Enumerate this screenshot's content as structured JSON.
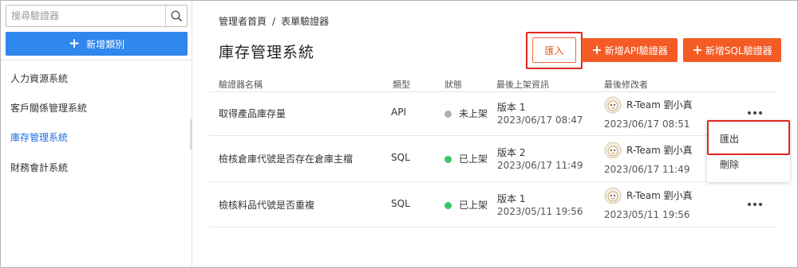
{
  "sidebar": {
    "search_placeholder": "搜尋驗證器",
    "add_category_label": "新增類別",
    "items": [
      {
        "label": "人力資源系統",
        "active": false
      },
      {
        "label": "客戶關係管理系統",
        "active": false
      },
      {
        "label": "庫存管理系統",
        "active": true
      },
      {
        "label": "財務會計系統",
        "active": false
      }
    ]
  },
  "breadcrumb": {
    "home": "管理者首頁",
    "separator": "/",
    "current": "表單驗證器"
  },
  "page_title": "庫存管理系統",
  "toolbar": {
    "import_label": "匯入",
    "add_api_label": "新增API驗證器",
    "add_sql_label": "新增SQL驗證器"
  },
  "table": {
    "headers": [
      "驗證器名稱",
      "類型",
      "狀態",
      "最後上架資訊",
      "最後修改者"
    ],
    "rows": [
      {
        "name": "取得產品庫存量",
        "type": "API",
        "status": "未上架",
        "status_color": "#b0b0b0",
        "version": "版本 1",
        "release_time": "2023/06/17 08:47",
        "modifier": "R-Team 劉小真",
        "modified_time": "2023/06/17 08:51"
      },
      {
        "name": "檢核倉庫代號是否存在倉庫主檔",
        "type": "SQL",
        "status": "已上架",
        "status_color": "#3cc56b",
        "version": "版本 2",
        "release_time": "2023/06/17 11:49",
        "modifier": "R-Team 劉小真",
        "modified_time": "2023/06/17 11:49"
      },
      {
        "name": "檢核料品代號是否重複",
        "type": "SQL",
        "status": "已上架",
        "status_color": "#3cc56b",
        "version": "版本 1",
        "release_time": "2023/05/11 19:56",
        "modifier": "R-Team 劉小真",
        "modified_time": "2023/05/11 19:56"
      }
    ]
  },
  "row_menu": {
    "export_label": "匯出",
    "delete_label": "刪除"
  },
  "colors": {
    "primary_blue": "#2f86ec",
    "accent_orange": "#f45b25",
    "highlight_red": "#e0281e",
    "active_link": "#1d6fe0"
  }
}
